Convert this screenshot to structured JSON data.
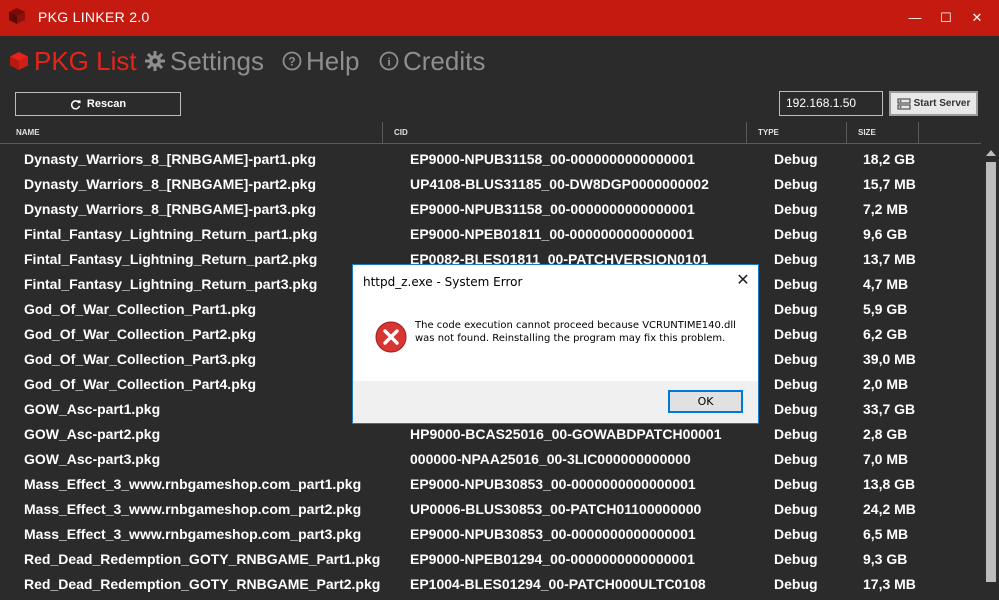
{
  "window": {
    "title": "PKG LINKER 2.0",
    "controls": {
      "minimize": "—",
      "maximize": "☐",
      "close": "✕"
    },
    "accent_color": "#c41a10"
  },
  "nav": {
    "items": [
      {
        "label": "PKG List",
        "icon": "package-icon",
        "active": true
      },
      {
        "label": "Settings",
        "icon": "gear-icon",
        "active": false
      },
      {
        "label": "Help",
        "icon": "help-icon",
        "active": false
      },
      {
        "label": "Credits",
        "icon": "info-icon",
        "active": false
      }
    ]
  },
  "toolbar": {
    "rescan_label": "Rescan",
    "ip_value": "192.168.1.50",
    "start_server_label": "Start Server"
  },
  "table": {
    "columns": [
      "NAME",
      "CID",
      "TYPE",
      "SIZE"
    ],
    "rows": [
      [
        "Dynasty_Warriors_8_[RNBGAME]-part1.pkg",
        "EP9000-NPUB31158_00-0000000000000001",
        "Debug",
        "18,2 GB"
      ],
      [
        "Dynasty_Warriors_8_[RNBGAME]-part2.pkg",
        "UP4108-BLUS31185_00-DW8DGP0000000002",
        "Debug",
        "15,7 MB"
      ],
      [
        "Dynasty_Warriors_8_[RNBGAME]-part3.pkg",
        "EP9000-NPUB31158_00-0000000000000001",
        "Debug",
        "7,2 MB"
      ],
      [
        "Fintal_Fantasy_Lightning_Return_part1.pkg",
        "EP9000-NPEB01811_00-0000000000000001",
        "Debug",
        "9,6 GB"
      ],
      [
        "Fintal_Fantasy_Lightning_Return_part2.pkg",
        "EP0082-BLES01811_00-PATCHVERSION0101",
        "Debug",
        "13,7 MB"
      ],
      [
        "Fintal_Fantasy_Lightning_Return_part3.pkg",
        "",
        "Debug",
        "4,7 MB"
      ],
      [
        "God_Of_War_Collection_Part1.pkg",
        "",
        "Debug",
        "5,9 GB"
      ],
      [
        "God_Of_War_Collection_Part2.pkg",
        "",
        "Debug",
        "6,2 GB"
      ],
      [
        "God_Of_War_Collection_Part3.pkg",
        "",
        "Debug",
        "39,0 MB"
      ],
      [
        "God_Of_War_Collection_Part4.pkg",
        "",
        "Debug",
        "2,0 MB"
      ],
      [
        "GOW_Asc-part1.pkg",
        "",
        "Debug",
        "33,7 GB"
      ],
      [
        "GOW_Asc-part2.pkg",
        "HP9000-BCAS25016_00-GOWABDPATCH00001",
        "Debug",
        "2,8 GB"
      ],
      [
        "GOW_Asc-part3.pkg",
        "000000-NPAA25016_00-3LIC000000000000",
        "Debug",
        "7,0 MB"
      ],
      [
        "Mass_Effect_3_www.rnbgameshop.com_part1.pkg",
        "EP9000-NPUB30853_00-0000000000000001",
        "Debug",
        "13,8 GB"
      ],
      [
        "Mass_Effect_3_www.rnbgameshop.com_part2.pkg",
        "UP0006-BLUS30853_00-PATCH01100000000",
        "Debug",
        "24,2 MB"
      ],
      [
        "Mass_Effect_3_www.rnbgameshop.com_part3.pkg",
        "EP9000-NPUB30853_00-0000000000000001",
        "Debug",
        "6,5 MB"
      ],
      [
        "Red_Dead_Redemption_GOTY_RNBGAME_Part1.pkg",
        "EP9000-NPEB01294_00-0000000000000001",
        "Debug",
        "9,3 GB"
      ],
      [
        "Red_Dead_Redemption_GOTY_RNBGAME_Part2.pkg",
        "EP1004-BLES01294_00-PATCH000ULTC0108",
        "Debug",
        "17,3 MB"
      ]
    ]
  },
  "dialog": {
    "title": "httpd_z.exe - System Error",
    "close": "✕",
    "message": "The code execution cannot proceed because VCRUNTIME140.dll was not found. Reinstalling the program may fix this problem.",
    "ok_label": "OK",
    "icon": "error-icon"
  }
}
